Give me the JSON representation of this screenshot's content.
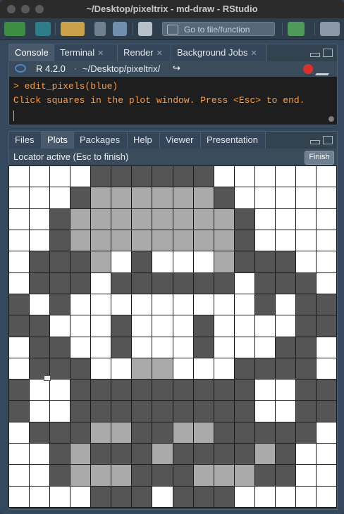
{
  "window": {
    "title": "~/Desktop/pixeltrix - md-draw - RStudio"
  },
  "toolbar": {
    "goto_label": "Go to file/function"
  },
  "console_pane": {
    "tabs": [
      {
        "label": "Console",
        "active": true,
        "closable": false
      },
      {
        "label": "Terminal",
        "active": false,
        "closable": true
      },
      {
        "label": "Render",
        "active": false,
        "closable": true
      },
      {
        "label": "Background Jobs",
        "active": false,
        "closable": true
      }
    ],
    "r_version": "R 4.2.0",
    "path": "~/Desktop/pixeltrix/",
    "lines": [
      "> edit_pixels(blue)",
      "Click squares in the plot window. Press <Esc> to end."
    ]
  },
  "plots_pane": {
    "tabs": [
      {
        "label": "Files",
        "active": false
      },
      {
        "label": "Plots",
        "active": true
      },
      {
        "label": "Packages",
        "active": false
      },
      {
        "label": "Help",
        "active": false
      },
      {
        "label": "Viewer",
        "active": false
      },
      {
        "label": "Presentation",
        "active": false
      }
    ],
    "status": "Locator active (Esc to finish)",
    "finish_label": "Finish"
  },
  "pixel_grid": {
    "palette": {
      "0": "#ffffff",
      "1": "#555555",
      "2": "#aaaaaa"
    },
    "rows": [
      "0000111111000000",
      "0001222222100000",
      "0012222222210000",
      "0012222222210000",
      "0111201000211100",
      "0111011111101110",
      "1010000000001011",
      "1100010001000011",
      "0110010001000110",
      "0111002200011110",
      "1001111111110011",
      "1001111111110011",
      "0111221122111110",
      "0012111211112100",
      "0012221112221100",
      "0000111011100000"
    ]
  }
}
